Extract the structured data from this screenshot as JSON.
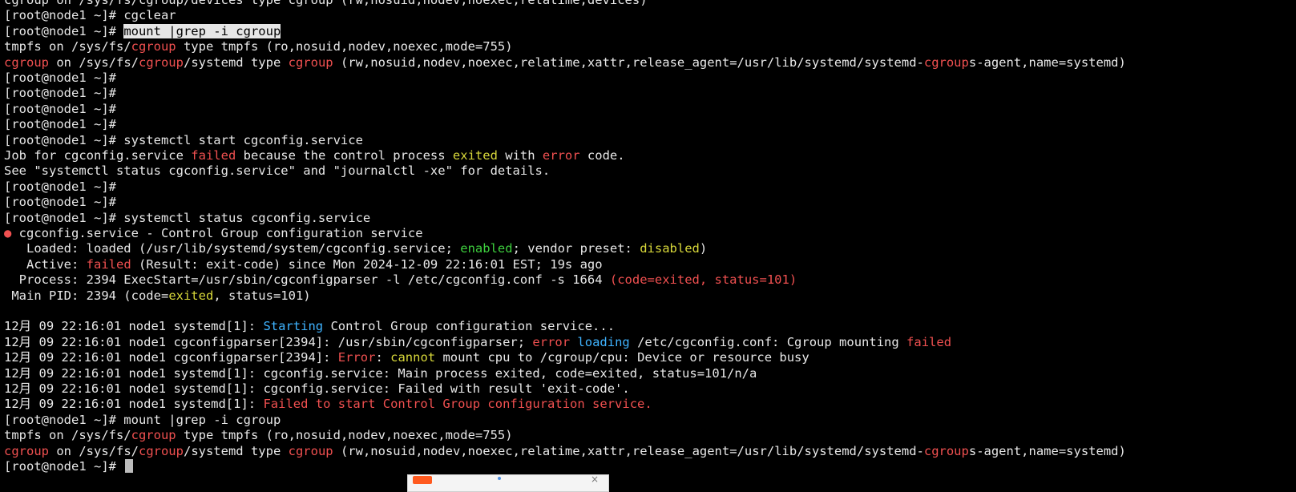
{
  "colors": {
    "background": "#000000",
    "default": "#e8e8e8",
    "red": "#f05050",
    "yellow": "#d8d83a",
    "green": "#3ed03e",
    "cyan": "#3fb3ff",
    "highlight_bg": "#e6e6e6",
    "highlight_fg": "#000000",
    "cursor": "#bcbcbc"
  },
  "terminal": {
    "lines": [
      {
        "segments": [
          {
            "t": "cgroup on /sys/fs/cgroup/devices type cgroup (rw,nosuid,nodev,noexec,relatime,devices)",
            "c": "default"
          }
        ]
      },
      {
        "segments": [
          {
            "t": "[root@node1 ~]# ",
            "c": "default"
          },
          {
            "t": "cgclear",
            "c": "default"
          }
        ]
      },
      {
        "segments": [
          {
            "t": "[root@node1 ~]# ",
            "c": "default"
          },
          {
            "t": "mount |grep -i cgroup",
            "c": "highlight"
          }
        ]
      },
      {
        "segments": [
          {
            "t": "tmpfs on /sys/fs/",
            "c": "default"
          },
          {
            "t": "cgroup",
            "c": "red"
          },
          {
            "t": " type tmpfs (ro,nosuid,nodev,noexec,mode=755)",
            "c": "default"
          }
        ]
      },
      {
        "segments": [
          {
            "t": "cgroup",
            "c": "red"
          },
          {
            "t": " on /sys/fs/",
            "c": "default"
          },
          {
            "t": "cgroup",
            "c": "red"
          },
          {
            "t": "/systemd type ",
            "c": "default"
          },
          {
            "t": "cgroup",
            "c": "red"
          },
          {
            "t": " (rw,nosuid,nodev,noexec,relatime,xattr,release_agent=/usr/lib/systemd/systemd-",
            "c": "default"
          },
          {
            "t": "cgroup",
            "c": "red"
          },
          {
            "t": "s-agent,name=systemd)",
            "c": "default"
          }
        ]
      },
      {
        "segments": [
          {
            "t": "[root@node1 ~]#",
            "c": "default"
          }
        ]
      },
      {
        "segments": [
          {
            "t": "[root@node1 ~]#",
            "c": "default"
          }
        ]
      },
      {
        "segments": [
          {
            "t": "[root@node1 ~]#",
            "c": "default"
          }
        ]
      },
      {
        "segments": [
          {
            "t": "[root@node1 ~]#",
            "c": "default"
          }
        ]
      },
      {
        "segments": [
          {
            "t": "[root@node1 ~]# systemctl start cgconfig.service",
            "c": "default"
          }
        ]
      },
      {
        "segments": [
          {
            "t": "Job for cgconfig.service ",
            "c": "default"
          },
          {
            "t": "failed",
            "c": "red"
          },
          {
            "t": " because the control process ",
            "c": "default"
          },
          {
            "t": "exited",
            "c": "yellow"
          },
          {
            "t": " with ",
            "c": "default"
          },
          {
            "t": "error",
            "c": "red"
          },
          {
            "t": " code.",
            "c": "default"
          }
        ]
      },
      {
        "segments": [
          {
            "t": "See \"systemctl status cgconfig.service\" and \"journalctl -xe\" for details.",
            "c": "default"
          }
        ]
      },
      {
        "segments": [
          {
            "t": "[root@node1 ~]#",
            "c": "default"
          }
        ]
      },
      {
        "segments": [
          {
            "t": "[root@node1 ~]#",
            "c": "default"
          }
        ]
      },
      {
        "segments": [
          {
            "t": "[root@node1 ~]# systemctl status cgconfig.service",
            "c": "default"
          }
        ]
      },
      {
        "segments": [
          {
            "t": "●",
            "c": "red"
          },
          {
            "t": " cgconfig.service - Control Group configuration service",
            "c": "default"
          }
        ]
      },
      {
        "segments": [
          {
            "t": "   Loaded: loaded (/usr/lib/systemd/system/cgconfig.service; ",
            "c": "default"
          },
          {
            "t": "enabled",
            "c": "green"
          },
          {
            "t": "; vendor preset: ",
            "c": "default"
          },
          {
            "t": "disabled",
            "c": "yellow"
          },
          {
            "t": ")",
            "c": "default"
          }
        ]
      },
      {
        "segments": [
          {
            "t": "   Active: ",
            "c": "default"
          },
          {
            "t": "failed",
            "c": "red"
          },
          {
            "t": " (Result: exit-code) since Mon 2024-12-09 22:16:01 EST; 19s ago",
            "c": "default"
          }
        ]
      },
      {
        "segments": [
          {
            "t": "  Process: 2394 ExecStart=/usr/sbin/cgconfigparser -l /etc/cgconfig.conf -s 1664 ",
            "c": "default"
          },
          {
            "t": "(code=exited, status=101)",
            "c": "red"
          }
        ]
      },
      {
        "segments": [
          {
            "t": " Main PID: 2394 (code=",
            "c": "default"
          },
          {
            "t": "exited",
            "c": "yellow"
          },
          {
            "t": ", status=101)",
            "c": "default"
          }
        ]
      },
      {
        "segments": [
          {
            "t": "",
            "c": "default"
          }
        ]
      },
      {
        "segments": [
          {
            "t": "12月 09 22:16:01 node1 systemd[1]: ",
            "c": "default"
          },
          {
            "t": "Starting",
            "c": "cyan"
          },
          {
            "t": " Control Group configuration service...",
            "c": "default"
          }
        ]
      },
      {
        "segments": [
          {
            "t": "12月 09 22:16:01 node1 cgconfigparser[2394]: /usr/sbin/cgconfigparser; ",
            "c": "default"
          },
          {
            "t": "error",
            "c": "red"
          },
          {
            "t": " ",
            "c": "default"
          },
          {
            "t": "loading",
            "c": "cyan"
          },
          {
            "t": " /etc/cgconfig.conf: Cgroup mounting ",
            "c": "default"
          },
          {
            "t": "failed",
            "c": "red"
          }
        ]
      },
      {
        "segments": [
          {
            "t": "12月 09 22:16:01 node1 cgconfigparser[2394]: ",
            "c": "default"
          },
          {
            "t": "Error",
            "c": "red"
          },
          {
            "t": ": ",
            "c": "default"
          },
          {
            "t": "cannot",
            "c": "yellow"
          },
          {
            "t": " mount cpu to /cgroup/cpu: Device or resource busy",
            "c": "default"
          }
        ]
      },
      {
        "segments": [
          {
            "t": "12月 09 22:16:01 node1 systemd[1]: cgconfig.service: Main process exited, code=exited, status=101/n/a",
            "c": "default"
          }
        ]
      },
      {
        "segments": [
          {
            "t": "12月 09 22:16:01 node1 systemd[1]: cgconfig.service: Failed with result 'exit-code'.",
            "c": "default"
          }
        ]
      },
      {
        "segments": [
          {
            "t": "12月 09 22:16:01 node1 systemd[1]: ",
            "c": "default"
          },
          {
            "t": "Failed to start Control Group configuration service.",
            "c": "red"
          }
        ]
      },
      {
        "segments": [
          {
            "t": "[root@node1 ~]# mount |grep -i cgroup",
            "c": "default"
          }
        ]
      },
      {
        "segments": [
          {
            "t": "tmpfs on /sys/fs/",
            "c": "default"
          },
          {
            "t": "cgroup",
            "c": "red"
          },
          {
            "t": " type tmpfs (ro,nosuid,nodev,noexec,mode=755)",
            "c": "default"
          }
        ]
      },
      {
        "segments": [
          {
            "t": "cgroup",
            "c": "red"
          },
          {
            "t": " on /sys/fs/",
            "c": "default"
          },
          {
            "t": "cgroup",
            "c": "red"
          },
          {
            "t": "/systemd type ",
            "c": "default"
          },
          {
            "t": "cgroup",
            "c": "red"
          },
          {
            "t": " (rw,nosuid,nodev,noexec,relatime,xattr,release_agent=/usr/lib/systemd/systemd-",
            "c": "default"
          },
          {
            "t": "cgroup",
            "c": "red"
          },
          {
            "t": "s-agent,name=systemd)",
            "c": "default"
          }
        ]
      },
      {
        "segments": [
          {
            "t": "[root@node1 ~]# ",
            "c": "default"
          }
        ],
        "cursor": true
      }
    ]
  }
}
